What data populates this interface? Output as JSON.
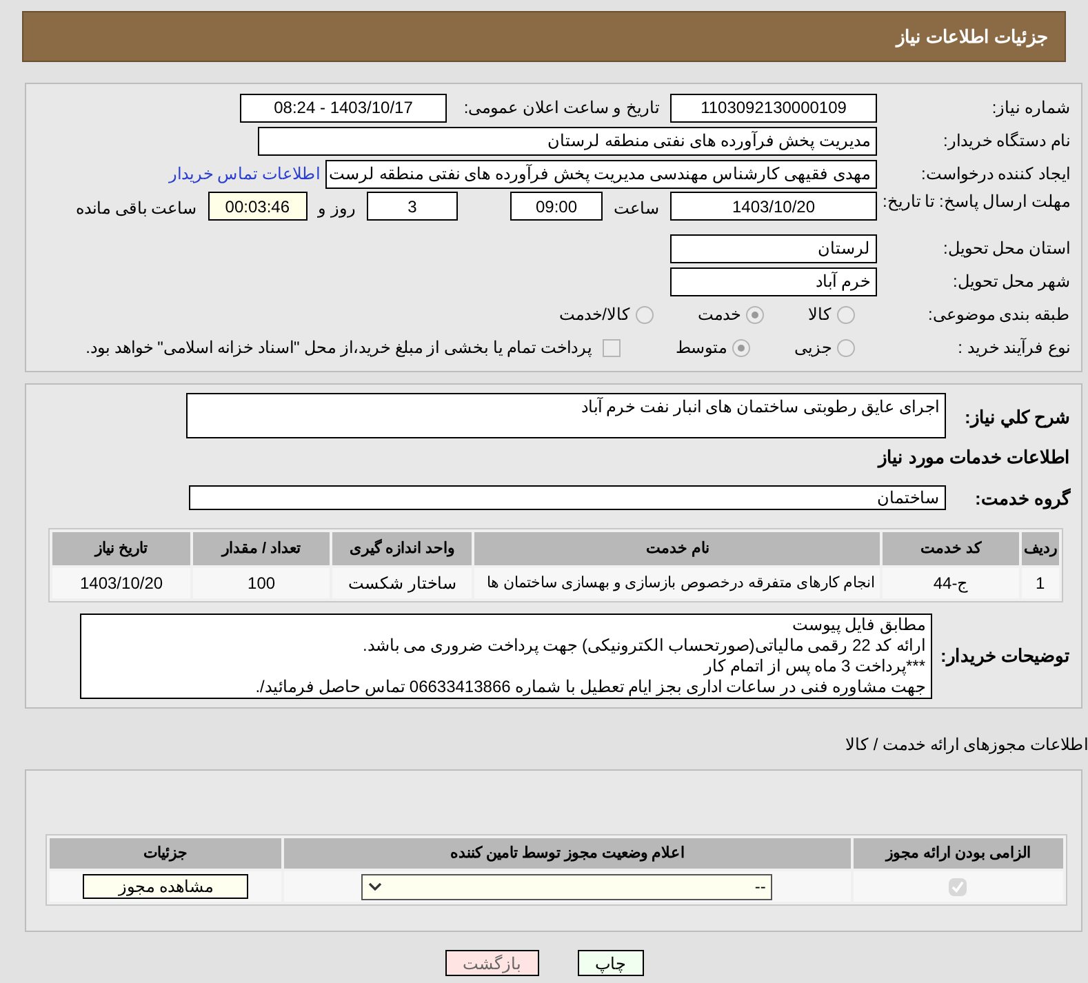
{
  "header": {
    "title": "جزئیات اطلاعات نیاز"
  },
  "details": {
    "need_number": {
      "label": "شماره نیاز:",
      "value": "1103092130000109"
    },
    "announce": {
      "label": "تاریخ و ساعت اعلان عمومی:",
      "value": "1403/10/17 - 08:24"
    },
    "buyer_org": {
      "label": "نام دستگاه خریدار:",
      "value": "مدیریت پخش فرآورده های نفتی منطقه لرستان"
    },
    "requester": {
      "label": "ایجاد کننده درخواست:",
      "value": "مهدی فقیهی کارشناس مهندسی مدیریت پخش فرآورده های نفتی منطقه لرست",
      "link": "اطلاعات تماس خریدار"
    },
    "deadline": {
      "label": "مهلت ارسال پاسخ: تا تاریخ:",
      "date": "1403/10/20",
      "time_label": "ساعت",
      "time": "09:00",
      "days": "3",
      "days_label": "روز و",
      "remaining": "00:03:46",
      "remaining_label": "ساعت باقی مانده"
    },
    "province": {
      "label": "استان محل تحویل:",
      "value": "لرستان"
    },
    "city": {
      "label": "شهر محل تحویل:",
      "value": "خرم آباد"
    },
    "category": {
      "label": "طبقه بندی موضوعی:",
      "options": [
        {
          "label": "کالا",
          "selected": false
        },
        {
          "label": "خدمت",
          "selected": true
        },
        {
          "label": "کالا/خدمت",
          "selected": false
        }
      ]
    },
    "purchase_type": {
      "label": "نوع فرآیند خرید :",
      "options": [
        {
          "label": "جزیی",
          "selected": false
        },
        {
          "label": "متوسط",
          "selected": true
        }
      ],
      "payment": {
        "label": "پرداخت تمام یا بخشی از مبلغ خرید،از محل \"اسناد خزانه اسلامی\" خواهد بود.",
        "checked": false
      }
    }
  },
  "description": {
    "label": "شرح کلي نياز:",
    "value": "اجرای عایق رطوبتی ساختمان های انبار نفت خرم آباد"
  },
  "services": {
    "heading": "اطلاعات خدمات مورد نیاز",
    "group": {
      "label": "گروه خدمت:",
      "value": "ساختمان"
    },
    "table": {
      "columns": [
        "ردیف",
        "کد خدمت",
        "نام خدمت",
        "واحد اندازه گیری",
        "تعداد / مقدار",
        "تاریخ نیاز"
      ],
      "rows": [
        [
          "1",
          "ج-44",
          "انجام کارهای متفرقه درخصوص بازسازی و بهسازی ساختمان ها",
          "ساختار شکست",
          "100",
          "1403/10/20"
        ]
      ]
    }
  },
  "buyer_notes": {
    "label": "توضیحات خریدار:",
    "lines": [
      "مطابق فایل پیوست",
      "ارائه کد 22 رقمی مالیاتی(صورتحساب الکترونیکی) جهت پرداخت ضروری می باشد.",
      "***پرداخت 3 ماه پس از اتمام کار",
      "جهت مشاوره فنی در ساعات اداری بجز ایام تعطیل با شماره 06633413866 تماس حاصل فرمائید/."
    ]
  },
  "permits": {
    "title": "اطلاعات مجوزهای ارائه خدمت / کالا",
    "columns": [
      "الزامی بودن ارائه مجوز",
      "اعلام وضعیت مجوز توسط تامین کننده",
      "جزئیات"
    ],
    "rows": [
      {
        "mandatory": true,
        "status": "--",
        "details": "مشاهده مجوز"
      }
    ]
  },
  "buttons": [
    {
      "label": "چاپ",
      "kind": "print"
    },
    {
      "label": "بازگشت",
      "kind": "back"
    }
  ]
}
